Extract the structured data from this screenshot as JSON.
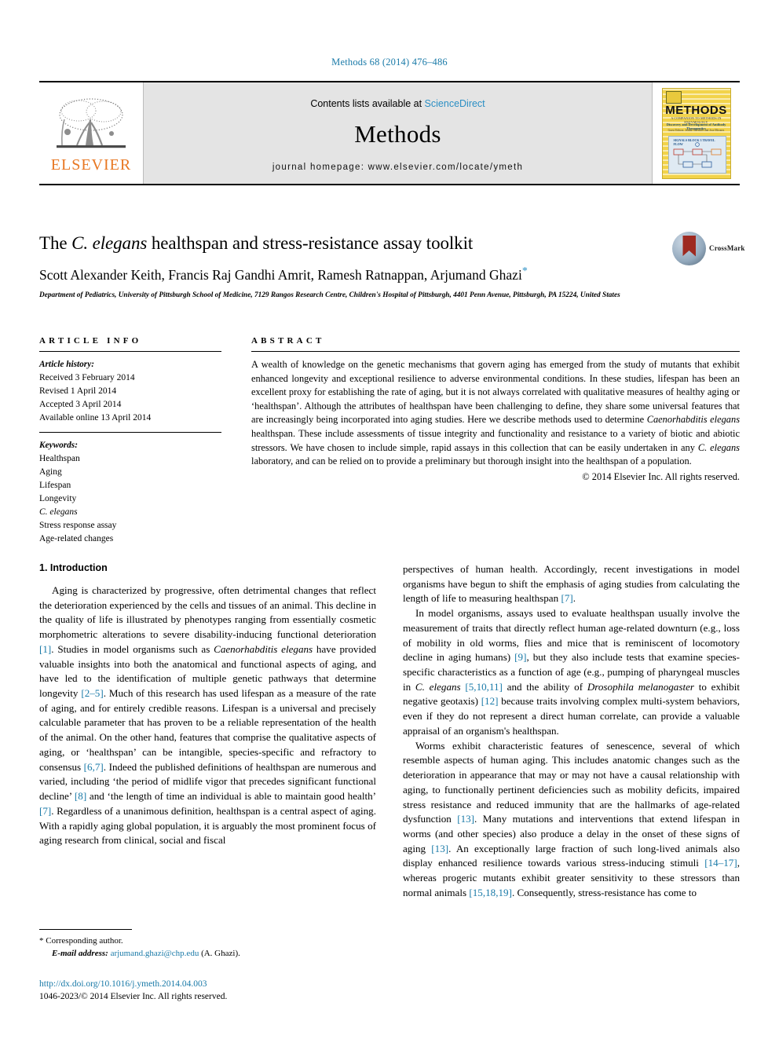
{
  "running_head": "Methods 68 (2014) 476–486",
  "masthead": {
    "publisher_name": "ELSEVIER",
    "contents_prefix": "Contents lists available at ",
    "contents_link": "ScienceDirect",
    "journal_name": "Methods",
    "homepage": "journal homepage: www.elsevier.com/locate/ymeth",
    "cover": {
      "title": "METHODS",
      "sub1": "A COMPANION TO METHODS IN ENZYMOLOGY",
      "sub2": "Discovery and Development of Antibody Therapeutics",
      "sub3": "Guest Editors: Jeanne Sisemore and Jose Mirones",
      "diagram_label": "SIGNALS BLOCK 3 TRAVEL FLOW"
    }
  },
  "article": {
    "title_pre": "The ",
    "title_italic": "C. elegans",
    "title_post": " healthspan and stress-resistance assay toolkit",
    "authors": "Scott Alexander Keith, Francis Raj Gandhi Amrit, Ramesh Ratnappan, Arjumand Ghazi",
    "author_star": "*",
    "affiliation": "Department of Pediatrics, University of Pittsburgh School of Medicine, 7129 Rangos Research Centre, Children's Hospital of Pittsburgh, 4401 Penn Avenue, Pittsburgh, PA 15224, United States",
    "crossmark_label": "CrossMark"
  },
  "article_info": {
    "heading": "ARTICLE INFO",
    "history_label": "Article history:",
    "history": [
      "Received 3 February 2014",
      "Revised 1 April 2014",
      "Accepted 3 April 2014",
      "Available online 13 April 2014"
    ],
    "keywords_label": "Keywords:",
    "keywords": [
      "Healthspan",
      "Aging",
      "Lifespan",
      "Longevity",
      "C. elegans",
      "Stress response assay",
      "Age-related changes"
    ]
  },
  "abstract": {
    "heading": "ABSTRACT",
    "text_part1": "A wealth of knowledge on the genetic mechanisms that govern aging has emerged from the study of mutants that exhibit enhanced longevity and exceptional resilience to adverse environmental conditions. In these studies, lifespan has been an excellent proxy for establishing the rate of aging, but it is not always correlated with qualitative measures of healthy aging or ‘healthspan’. Although the attributes of healthspan have been challenging to define, they share some universal features that are increasingly being incorporated into aging studies. Here we describe methods used to determine ",
    "species_italic": "Caenorhabditis elegans",
    "text_part2": " healthspan. These include assessments of tissue integrity and functionality and resistance to a variety of biotic and abiotic stressors. We have chosen to include simple, rapid assays in this collection that can be easily undertaken in any ",
    "species_italic2": "C. elegans",
    "text_part3": " laboratory, and can be relied on to provide a preliminary but thorough insight into the healthspan of a population.",
    "copyright": "© 2014 Elsevier Inc. All rights reserved."
  },
  "introduction": {
    "heading": "1. Introduction",
    "left_para_1_a": "Aging is characterized by progressive, often detrimental changes that reflect the deterioration experienced by the cells and tissues of an animal. This decline in the quality of life is illustrated by phenotypes ranging from essentially cosmetic morphometric alterations to severe disability-inducing functional deterioration ",
    "ref_1": "[1]",
    "left_para_1_b": ". Studies in model organisms such as ",
    "italic_celegans_full": "Caenorhabditis elegans",
    "left_para_1_c": " have provided valuable insights into both the anatomical and functional aspects of aging, and have led to the identification of multiple genetic pathways that determine longevity ",
    "ref_2_5": "[2–5]",
    "left_para_1_d": ". Much of this research has used lifespan as a measure of the rate of aging, and for entirely credible reasons. Lifespan is a universal and precisely calculable parameter that has proven to be a reliable representation of the health of the animal. On the other hand, features that comprise the qualitative aspects of aging, or ‘healthspan’ can be intangible, species-specific and refractory to consensus ",
    "ref_6_7": "[6,7]",
    "left_para_1_e": ". Indeed the published definitions of healthspan are numerous and varied, including ‘the period of midlife vigor that precedes significant functional decline’ ",
    "ref_8": "[8]",
    "left_para_1_f": " and ‘the length of time an individual is able to maintain good health’ ",
    "ref_7": "[7]",
    "left_para_1_g": ". Regardless of a unanimous definition, healthspan is a central aspect of aging. With a rapidly aging global population, it is arguably the most prominent focus of aging research from clinical, social and fiscal ",
    "right_para_1_a": "perspectives of human health. Accordingly, recent investigations in model organisms have begun to shift the emphasis of aging studies from calculating the length of life to measuring healthspan ",
    "right_ref_7": "[7]",
    "right_para_1_b": ".",
    "right_para_2_a": "In model organisms, assays used to evaluate healthspan usually involve the measurement of traits that directly reflect human age-related downturn (e.g., loss of mobility in old worms, flies and mice that is reminiscent of locomotory decline in aging humans) ",
    "right_ref_9": "[9]",
    "right_para_2_b": ", but they also include tests that examine species-specific characteristics as a function of age (e.g., pumping of pharyngeal muscles in ",
    "italic_celegans": "C. elegans",
    "right_para_2_c": " ",
    "right_ref_5_10_11": "[5,10,11]",
    "right_para_2_d": " and the ability of ",
    "italic_drosophila": "Drosophila melanogaster",
    "right_para_2_e": " to exhibit negative geotaxis) ",
    "right_ref_12": "[12]",
    "right_para_2_f": " because traits involving complex multi-system behaviors, even if they do not represent a direct human correlate, can provide a valuable appraisal of an organism's healthspan.",
    "right_para_3_a": "Worms exhibit characteristic features of senescence, several of which resemble aspects of human aging. This includes anatomic changes such as the deterioration in appearance that may or may not have a causal relationship with aging, to functionally pertinent deficiencies such as mobility deficits, impaired stress resistance and reduced immunity that are the hallmarks of age-related dysfunction ",
    "right_ref_13": "[13]",
    "right_para_3_b": ". Many mutations and interventions that extend lifespan in worms (and other species) also produce a delay in the onset of these signs of aging ",
    "right_ref_13b": "[13]",
    "right_para_3_c": ". An exceptionally large fraction of such long-lived animals also display enhanced resilience towards various stress-inducing stimuli ",
    "right_ref_14_17": "[14–17]",
    "right_para_3_d": ", whereas progeric mutants exhibit greater sensitivity to these stressors than normal animals ",
    "right_ref_15_18_19": "[15,18,19]",
    "right_para_3_e": ". Consequently, stress-resistance has come to"
  },
  "footnote": {
    "star": "*",
    "corresponding": " Corresponding author.",
    "email_label": "E-mail address:",
    "email": "arjumand.ghazi@chp.edu",
    "email_suffix": " (A. Ghazi).",
    "doi": "http://dx.doi.org/10.1016/j.ymeth.2014.04.003",
    "issn_line": "1046-2023/© 2014 Elsevier Inc. All rights reserved."
  },
  "colors": {
    "link": "#1a7aa8",
    "sciencedirect": "#2b8fc4",
    "elsevier_orange": "#E87722",
    "masthead_bg": "#e4e4e4",
    "cover_yellow": "#f2d34a"
  }
}
